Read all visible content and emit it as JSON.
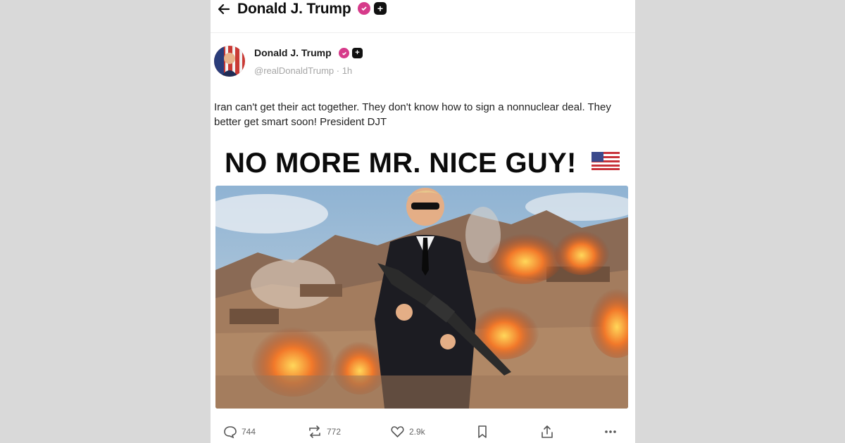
{
  "header": {
    "back_icon": "arrow-left-icon",
    "title": "Donald J. Trump"
  },
  "post": {
    "author_name": "Donald J. Trump",
    "handle": "@realDonaldTrump · 1h",
    "text": "Iran can't get their act together. They don't know how to sign a nonnuclear deal. They better get smart soon! President DJT",
    "image_headline": "NO MORE MR. NICE GUY!",
    "image_description": ""
  },
  "actions": {
    "replies": "744",
    "reposts": "772",
    "likes": "2.9k"
  },
  "colors": {
    "verified_badge": "#d63a8a",
    "page_background": "#d9d9d9"
  }
}
